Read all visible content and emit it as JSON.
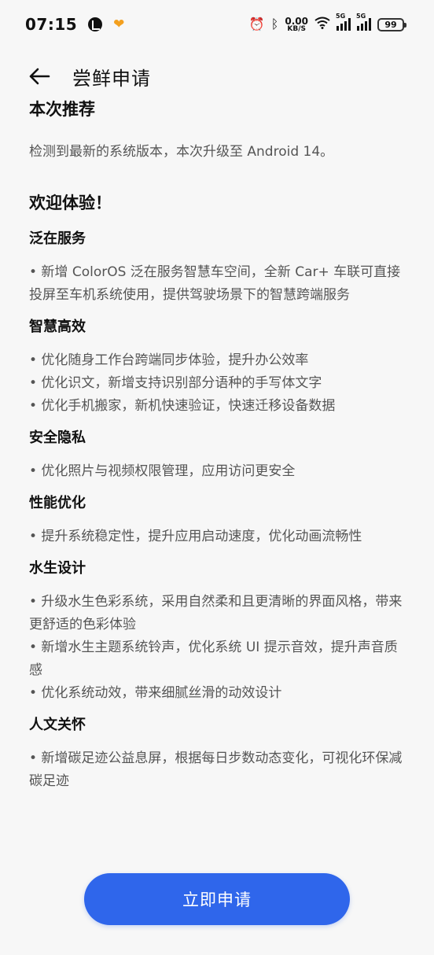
{
  "status_bar": {
    "time": "07:15",
    "speed_value": "0.00",
    "speed_unit": "KB/S",
    "network_1": "5G",
    "network_2": "5G",
    "battery": "99"
  },
  "header": {
    "title": "尝鲜申请"
  },
  "recommend": {
    "title": "本次推荐",
    "description": "检测到最新的系统版本，本次升级至 Android 14。"
  },
  "welcome": "欢迎体验！",
  "sections": [
    {
      "title": "泛在服务",
      "items": [
        "• 新增 ColorOS 泛在服务智慧车空间，全新 Car+ 车联可直接投屏至车机系统使用，提供驾驶场景下的智慧跨端服务"
      ]
    },
    {
      "title": "智慧高效",
      "items": [
        "• 优化随身工作台跨端同步体验，提升办公效率",
        " • 优化识文，新增支持识别部分语种的手写体文字",
        " • 优化手机搬家，新机快速验证，快速迁移设备数据"
      ]
    },
    {
      "title": "安全隐私",
      "items": [
        "• 优化照片与视频权限管理，应用访问更安全"
      ]
    },
    {
      "title": "性能优化",
      "items": [
        "• 提升系统稳定性，提升应用启动速度，优化动画流畅性"
      ]
    },
    {
      "title": "水生设计",
      "items": [
        "• 升级水生色彩系统，采用自然柔和且更清晰的界面风格，带来更舒适的色彩体验",
        " • 新增水生主题系统铃声，优化系统 UI 提示音效，提升声音质感",
        " • 优化系统动效，带来细腻丝滑的动效设计"
      ]
    },
    {
      "title": "人文关怀",
      "items": [
        "• 新增碳足迹公益息屏，根据每日步数动态变化，可视化环保减碳足迹"
      ]
    }
  ],
  "apply_button": "立即申请",
  "colors": {
    "background": "#f7f7f7",
    "primary_button": "#2f66eb",
    "heading": "#111111",
    "body_text": "#555555"
  }
}
